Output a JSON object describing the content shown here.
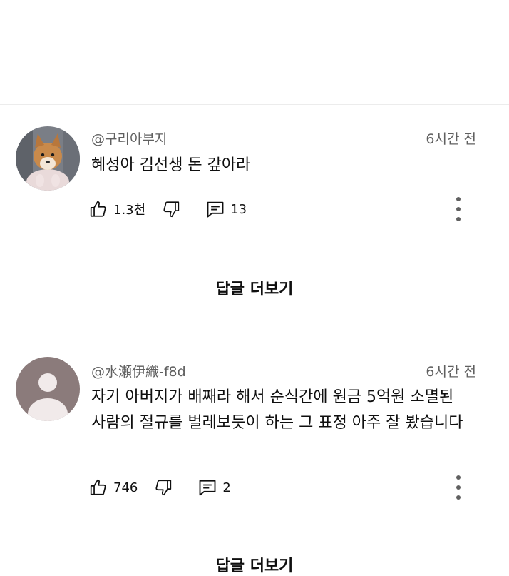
{
  "comments": [
    {
      "author": "@구리아부지",
      "time": "6시간 전",
      "text": "혜성아 김선생 돈 갚아라",
      "like_count": "1.3천",
      "reply_count": "13",
      "avatar": "shiba-dog-photo",
      "more_replies_label": "답글 더보기"
    },
    {
      "author": "@水瀬伊織-f8d",
      "time": "6시간 전",
      "text": "자기 아버지가 배째라 해서 순식간에 원금 5억원 소멸된 사람의 절규를 벌레보듯이 하는 그 표정 아주 잘 봤습니다",
      "like_count": "746",
      "reply_count": "2",
      "avatar": "default-avatar",
      "more_replies_label": "답글 더보기"
    }
  ],
  "icons": {
    "like": "thumbs-up-icon",
    "dislike": "thumbs-down-icon",
    "reply": "reply-bubble-icon",
    "menu": "more-vertical-icon"
  },
  "colors": {
    "secondary_text": "#606060",
    "primary_text": "#0f0f0f",
    "default_avatar_bg": "#8b7b7b"
  }
}
